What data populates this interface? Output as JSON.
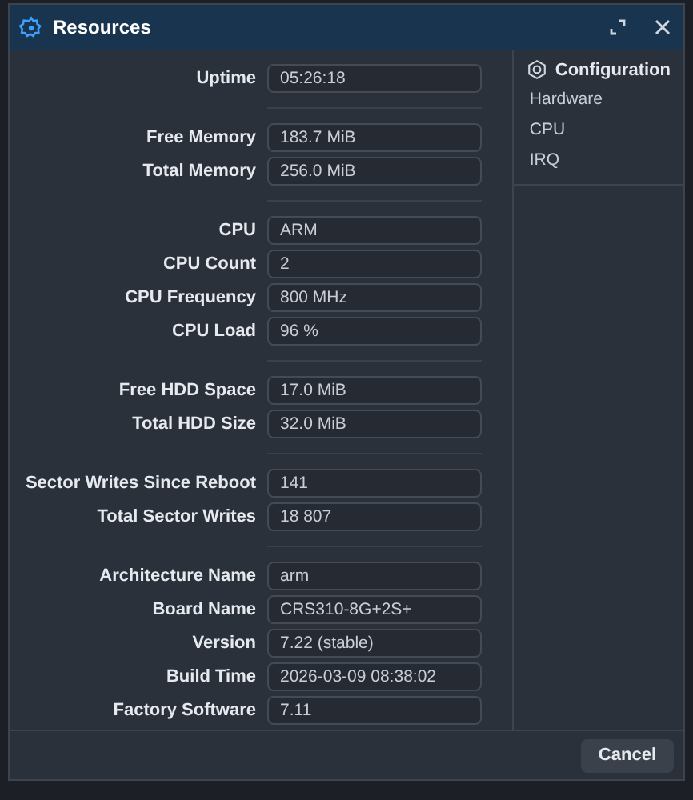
{
  "window": {
    "title": "Resources"
  },
  "groups": [
    [
      {
        "label": "Uptime",
        "value": "05:26:18"
      }
    ],
    [
      {
        "label": "Free Memory",
        "value": "183.7 MiB"
      },
      {
        "label": "Total Memory",
        "value": "256.0 MiB"
      }
    ],
    [
      {
        "label": "CPU",
        "value": "ARM"
      },
      {
        "label": "CPU Count",
        "value": "2"
      },
      {
        "label": "CPU Frequency",
        "value": "800 MHz"
      },
      {
        "label": "CPU Load",
        "value": "96 %"
      }
    ],
    [
      {
        "label": "Free HDD Space",
        "value": "17.0 MiB"
      },
      {
        "label": "Total HDD Size",
        "value": "32.0 MiB"
      }
    ],
    [
      {
        "label": "Sector Writes Since Reboot",
        "value": "141"
      },
      {
        "label": "Total Sector Writes",
        "value": "18 807"
      }
    ],
    [
      {
        "label": "Architecture Name",
        "value": "arm"
      },
      {
        "label": "Board Name",
        "value": "CRS310-8G+2S+"
      },
      {
        "label": "Version",
        "value": "7.22 (stable)"
      },
      {
        "label": "Build Time",
        "value": "2026-03-09 08:38:02"
      },
      {
        "label": "Factory Software",
        "value": "7.11"
      }
    ]
  ],
  "sidebar": {
    "title": "Configuration",
    "items": [
      "Hardware",
      "CPU",
      "IRQ"
    ]
  },
  "buttons": [
    "Cancel"
  ]
}
